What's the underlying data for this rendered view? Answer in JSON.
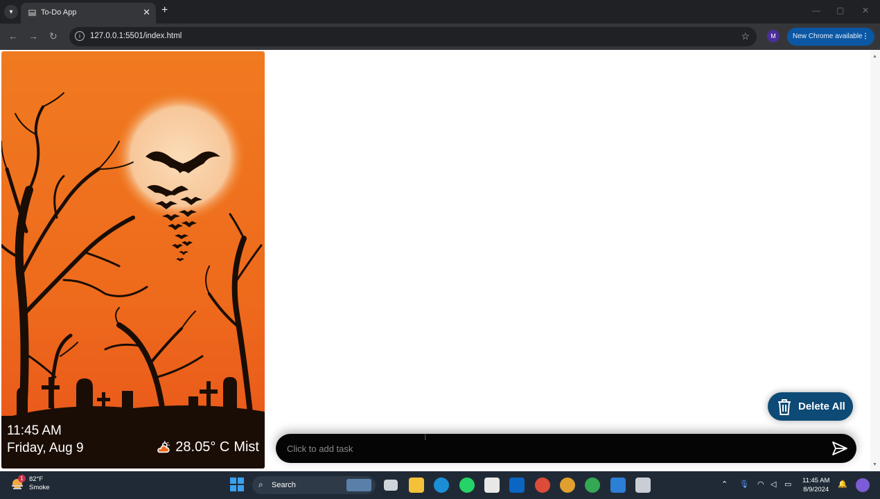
{
  "browser": {
    "tab_title": "To-Do App",
    "url": "127.0.0.1:5501/index.html",
    "profile_initial": "M",
    "update_label": "New Chrome available"
  },
  "app": {
    "time": "11:45 AM",
    "date": "Friday, Aug 9",
    "temperature": "28.05° C",
    "condition": "Mist",
    "weather_icon": "cloud-sun-icon",
    "delete_all_label": "Delete All",
    "task_placeholder": "Click to add task",
    "colors": {
      "sky_top": "#f07a20",
      "sky_bottom": "#e8541a",
      "moon": "#f9d2a8",
      "button": "#0d4a75",
      "input_bar": "#050505"
    }
  },
  "taskbar": {
    "weather_temp": "82°F",
    "weather_desc": "Smoke",
    "weather_badge": "1",
    "search_label": "Search",
    "clock_time": "11:45 AM",
    "clock_date": "8/9/2024"
  }
}
